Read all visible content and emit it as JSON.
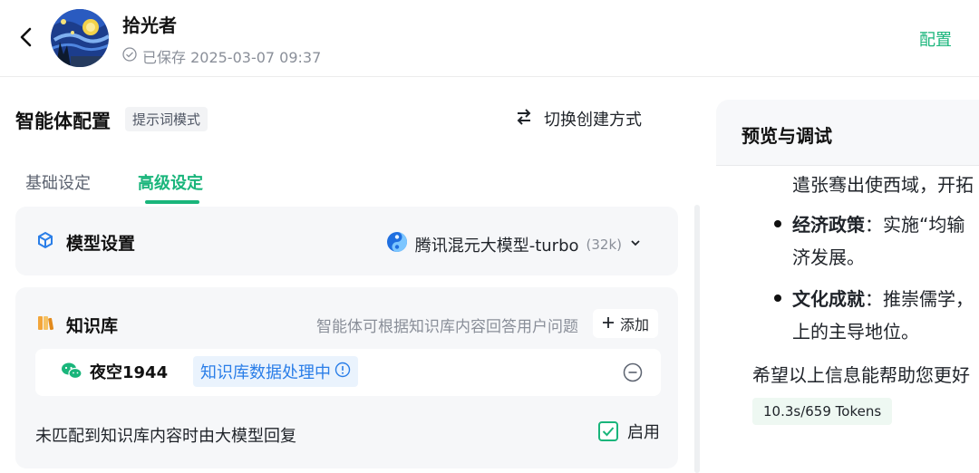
{
  "header": {
    "agent_name": "拾光者",
    "save_status": "已保存 2025-03-07 09:37",
    "config_link": "配置"
  },
  "left": {
    "title": "智能体配置",
    "mode_tag": "提示词模式",
    "switch_label": "切换创建方式",
    "tabs": [
      {
        "label": "基础设定",
        "active": false
      },
      {
        "label": "高级设定",
        "active": true
      }
    ],
    "model": {
      "title": "模型设置",
      "name": "腾讯混元大模型-turbo",
      "context": "(32k)"
    },
    "knowledge": {
      "title": "知识库",
      "description": "智能体可根据知识库内容回答用户问题",
      "add_label": "添加",
      "items": [
        {
          "name": "夜空1944",
          "status": "知识库数据处理中"
        }
      ],
      "fallback_label": "未匹配到知识库内容时由大模型回复",
      "fallback_toggle": "启用",
      "fallback_enabled": true
    }
  },
  "preview": {
    "title": "预览与调试",
    "lines": [
      {
        "text": "遣张骞出使西域，开拓"
      },
      {
        "bold": "经济政策",
        "rest": "：实施“均输"
      },
      {
        "text": "济发展。"
      },
      {
        "bold": "文化成就",
        "rest": "：推崇儒学，"
      },
      {
        "text": "上的主导地位。"
      },
      {
        "text": "希望以上信息能帮助您更好"
      }
    ],
    "tokens": "10.3s/659 Tokens"
  },
  "colors": {
    "accent": "#19b57b",
    "status_blue": "#2a7ee8"
  }
}
